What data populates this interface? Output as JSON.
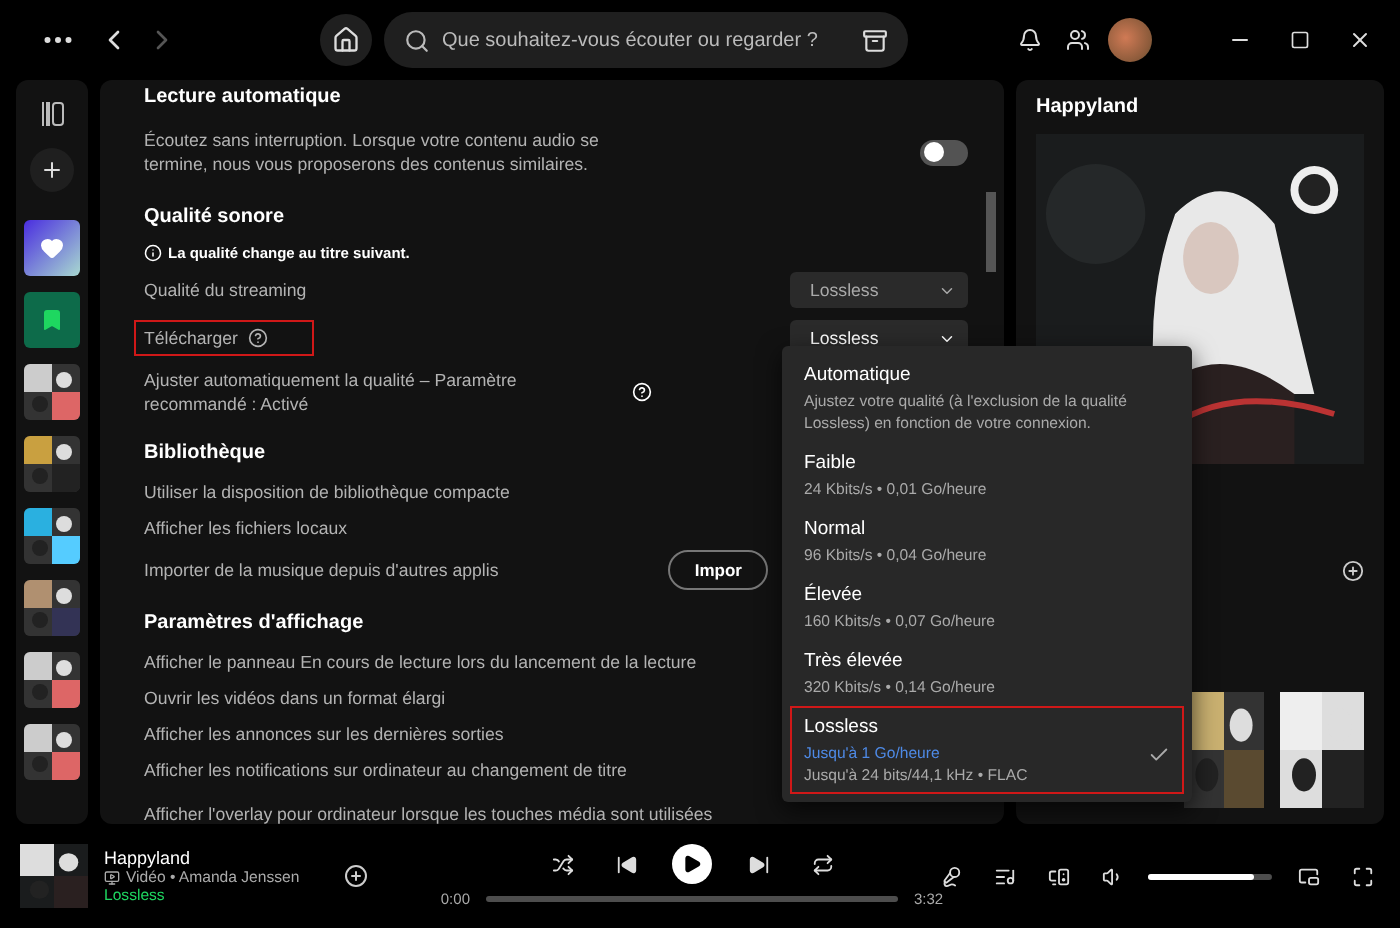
{
  "top_bar": {
    "search_placeholder": "Que souhaitez-vous écouter ou regarder ?"
  },
  "sidebar": {
    "items": [
      {
        "kind": "liked"
      },
      {
        "kind": "saved"
      },
      {
        "kind": "picture"
      },
      {
        "kind": "picture"
      },
      {
        "kind": "picture"
      },
      {
        "kind": "picture"
      },
      {
        "kind": "picture"
      },
      {
        "kind": "picture"
      }
    ]
  },
  "settings": {
    "sections": [
      {
        "title": "Lecture automatique",
        "rows": [
          {
            "kind": "toggle",
            "label": "Écoutez sans interruption. Lorsque votre contenu audio se termine, nous vous proposerons des contenus similaires.",
            "on": false
          }
        ]
      },
      {
        "title": "Qualité sonore",
        "rows": [
          {
            "kind": "note",
            "label": "La qualité change au titre suivant."
          },
          {
            "kind": "select",
            "label": "Qualité du streaming",
            "value": "Lossless",
            "open": false,
            "annotated": false
          },
          {
            "kind": "select",
            "label": "Télécharger",
            "value": "Lossless",
            "open": true,
            "annotated": true
          },
          {
            "kind": "help",
            "label": "Ajuster automatiquement la qualité – Paramètre recommandé : Activé"
          }
        ]
      },
      {
        "title": "Bibliothèque",
        "rows": [
          {
            "kind": "plain",
            "label": "Utiliser la disposition de bibliothèque compacte"
          },
          {
            "kind": "plain",
            "label": "Afficher les fichiers locaux"
          },
          {
            "kind": "button",
            "label": "Importer de la musique depuis d'autres applis",
            "button": "Impor"
          }
        ]
      },
      {
        "title": "Paramètres d'affichage",
        "rows": [
          {
            "kind": "plain",
            "label": "Afficher le panneau En cours de lecture lors du lancement de la lecture"
          },
          {
            "kind": "plain",
            "label": "Ouvrir les vidéos dans un format élargi"
          },
          {
            "kind": "plain",
            "label": "Afficher les annonces sur les dernières sorties"
          },
          {
            "kind": "plain",
            "label": "Afficher les notifications sur ordinateur au changement de titre"
          },
          {
            "kind": "plain",
            "label": "Afficher l'overlay pour ordinateur lorsque les touches média sont utilisées"
          }
        ]
      }
    ]
  },
  "quality_menu": {
    "options": [
      {
        "title": "Automatique",
        "detail": "Ajustez votre qualité (à l'exclusion de la qualité Lossless) en fonction de votre connexion.",
        "selected": false,
        "annotated": false
      },
      {
        "title": "Faible",
        "detail": "24 Kbits/s • 0,01 Go/heure",
        "selected": false,
        "annotated": false
      },
      {
        "title": "Normal",
        "detail": "96 Kbits/s • 0,04 Go/heure",
        "selected": false,
        "annotated": false
      },
      {
        "title": "Élevée",
        "detail": "160 Kbits/s • 0,07 Go/heure",
        "selected": false,
        "annotated": false
      },
      {
        "title": "Très élevée",
        "detail": "320 Kbits/s • 0,14 Go/heure",
        "selected": false,
        "annotated": false
      },
      {
        "title": "Lossless",
        "note": "Jusqu'à 1 Go/heure",
        "detail": "Jusqu'à 24 bits/44,1 kHz • FLAC",
        "selected": true,
        "annotated": true
      }
    ]
  },
  "now_playing_panel": {
    "title": "Happyland"
  },
  "player": {
    "title": "Happyland",
    "meta": "Vidéo • Amanda Jenssen",
    "quality": "Lossless",
    "elapsed": "0:00",
    "duration": "3:32",
    "progress": {
      "level": 0
    },
    "volume": {
      "level": 0.85
    }
  }
}
